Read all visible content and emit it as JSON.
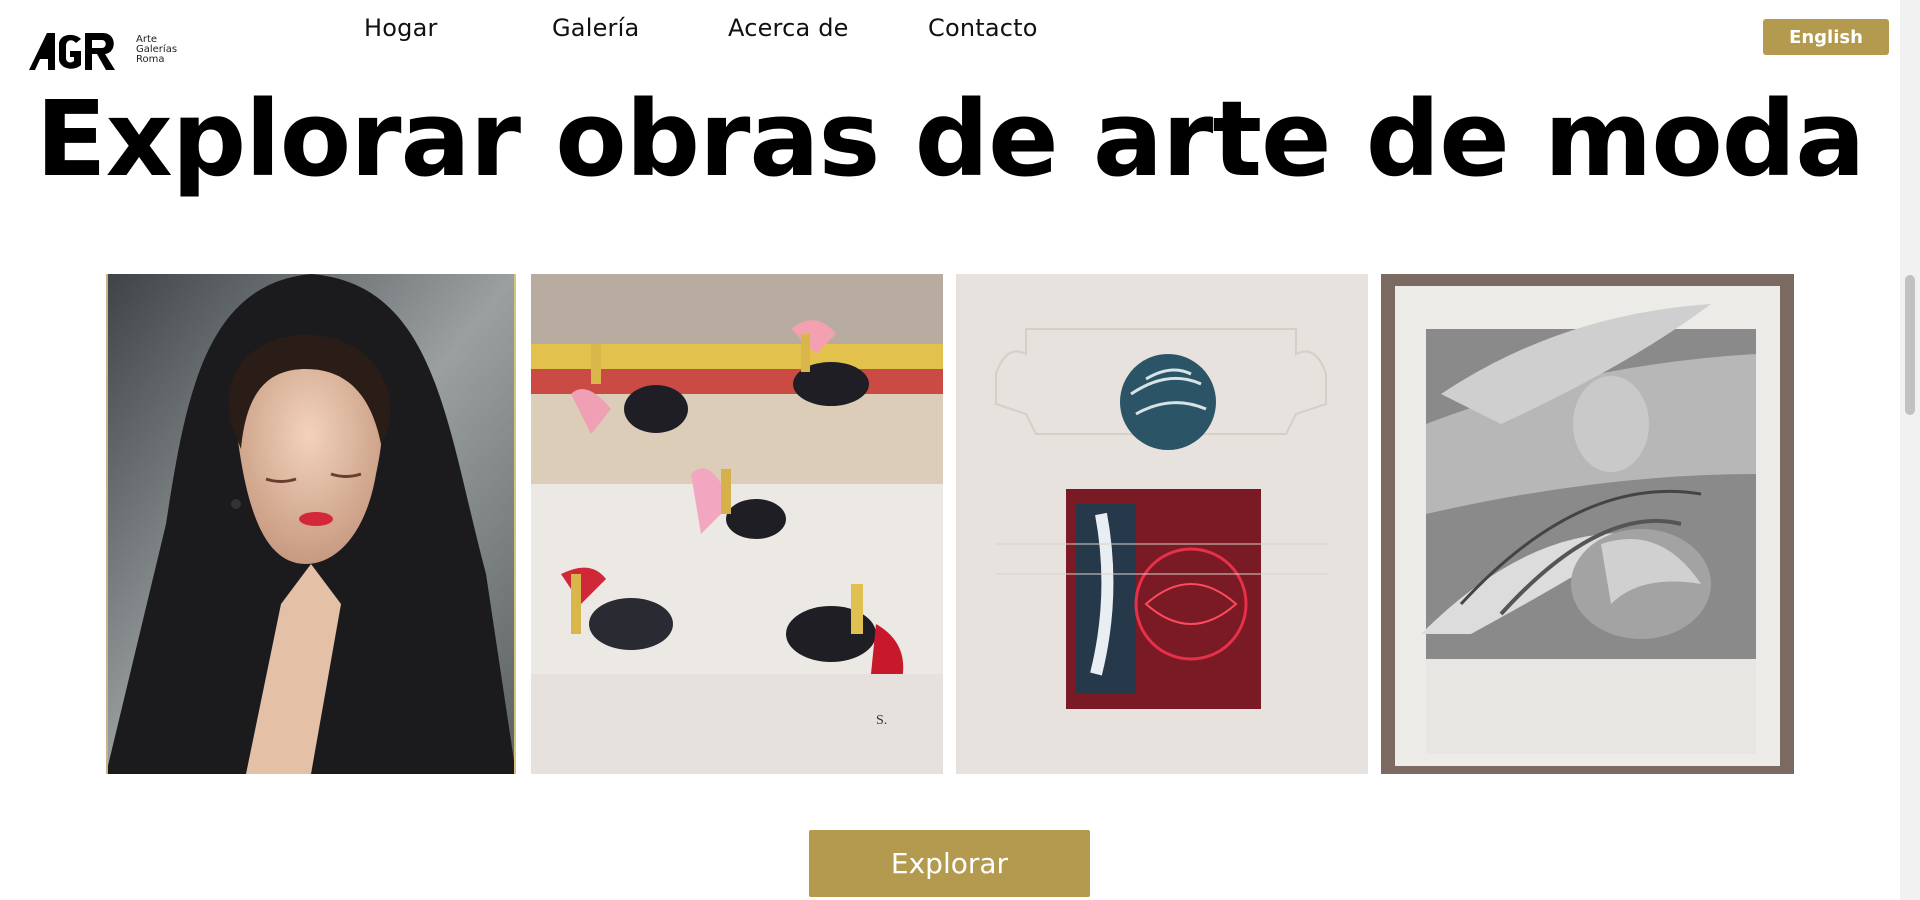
{
  "header": {
    "logo": {
      "mark_text": "AGR",
      "text_lines": [
        "Arte",
        "Galerías",
        "Roma"
      ]
    },
    "nav": [
      {
        "label": "Hogar"
      },
      {
        "label": "Galería"
      },
      {
        "label": "Acerca de"
      },
      {
        "label": "Contacto"
      }
    ],
    "language_button": "English"
  },
  "main": {
    "title": "Explorar obras de arte de moda",
    "artworks": [
      {
        "subject": "woman-with-black-mantilla"
      },
      {
        "subject": "bullfight-scenes"
      },
      {
        "subject": "abstract-feather-and-circle"
      },
      {
        "subject": "pencil-drawing-faces-and-birds"
      }
    ],
    "explore_button": "Explorar"
  },
  "colors": {
    "accent": "#b39a4f",
    "text": "#000000",
    "background": "#ffffff"
  }
}
